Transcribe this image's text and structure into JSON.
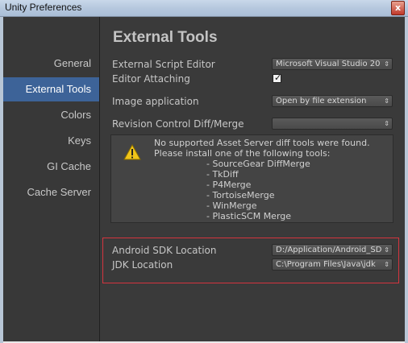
{
  "window": {
    "title": "Unity Preferences",
    "close_glyph": "x"
  },
  "sidebar": {
    "items": [
      {
        "label": "General",
        "active": false
      },
      {
        "label": "External Tools",
        "active": true
      },
      {
        "label": "Colors",
        "active": false
      },
      {
        "label": "Keys",
        "active": false
      },
      {
        "label": "GI Cache",
        "active": false
      },
      {
        "label": "Cache Server",
        "active": false
      }
    ]
  },
  "main": {
    "title": "External Tools",
    "script_editor": {
      "label": "External Script Editor",
      "value": "Microsoft Visual Studio 20"
    },
    "editor_attaching": {
      "label": "Editor Attaching",
      "checked": true
    },
    "image_application": {
      "label": "Image application",
      "value": "Open by file extension"
    },
    "revision_control": {
      "label": "Revision Control Diff/Merge",
      "value": ""
    },
    "help": {
      "line1": "No supported Asset Server diff tools were found.",
      "line2": "Please install one of the following tools:",
      "tools": [
        "- SourceGear DiffMerge",
        "- TkDiff",
        "- P4Merge",
        "- TortoiseMerge",
        "- WinMerge",
        "- PlasticSCM Merge"
      ]
    },
    "android_sdk": {
      "label": "Android SDK Location",
      "value": "D:/Application/Android_SD"
    },
    "jdk": {
      "label": "JDK Location",
      "value": "C:\\Program Files\\Java\\jdk"
    }
  },
  "colors": {
    "selection": "#3d6398",
    "highlight_border": "#d4343e",
    "warning": "#f0c419"
  },
  "icons": {
    "warning": "warning-icon",
    "dropdown": "dropdown-arrow-icon",
    "check": "checkmark-icon"
  }
}
